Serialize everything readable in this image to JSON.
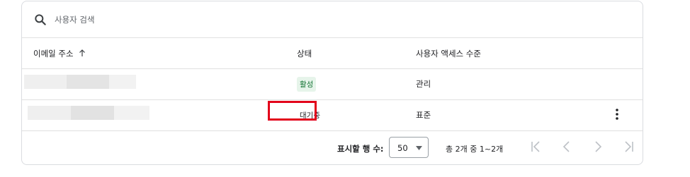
{
  "search": {
    "placeholder": "사용자 검색",
    "icon": "search-icon"
  },
  "table": {
    "columns": {
      "email": "이메일 주소",
      "status": "상태",
      "access": "사용자 액세스 수준"
    },
    "sort": {
      "column": "email",
      "direction": "ascending",
      "icon": "arrow-up-icon"
    },
    "rows": [
      {
        "email": "",
        "status": "활성",
        "access": "관리",
        "status_style": "active"
      },
      {
        "email": "",
        "status": "대기중",
        "access": "표준",
        "status_style": "pending",
        "highlighted": true
      }
    ]
  },
  "footer": {
    "rows_per_page_label": "표시할 행 수:",
    "rows_per_page_value": "50",
    "range_text": "총 2개 중 1~2개"
  },
  "colors": {
    "active_chip_bg": "#e6f4ea",
    "active_chip_text": "#137333",
    "highlight_border": "#e2001a",
    "disabled_icon": "#bdc1c6"
  }
}
